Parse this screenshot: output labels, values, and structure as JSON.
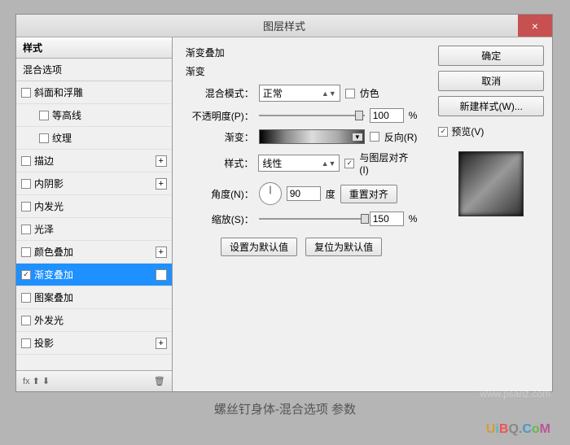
{
  "dialog": {
    "title": "图层样式",
    "close": "×"
  },
  "styles": {
    "header": "样式",
    "blend_options": "混合选项",
    "items": [
      {
        "label": "斜面和浮雕",
        "checked": false,
        "indent": false,
        "has_add": false
      },
      {
        "label": "等高线",
        "checked": false,
        "indent": true,
        "has_add": false
      },
      {
        "label": "纹理",
        "checked": false,
        "indent": true,
        "has_add": false
      },
      {
        "label": "描边",
        "checked": false,
        "indent": false,
        "has_add": true
      },
      {
        "label": "内阴影",
        "checked": false,
        "indent": false,
        "has_add": true
      },
      {
        "label": "内发光",
        "checked": false,
        "indent": false,
        "has_add": false
      },
      {
        "label": "光泽",
        "checked": false,
        "indent": false,
        "has_add": false
      },
      {
        "label": "颜色叠加",
        "checked": false,
        "indent": false,
        "has_add": true
      },
      {
        "label": "渐变叠加",
        "checked": true,
        "indent": false,
        "has_add": true,
        "selected": true
      },
      {
        "label": "图案叠加",
        "checked": false,
        "indent": false,
        "has_add": false
      },
      {
        "label": "外发光",
        "checked": false,
        "indent": false,
        "has_add": false
      },
      {
        "label": "投影",
        "checked": false,
        "indent": false,
        "has_add": true
      }
    ],
    "footer_left": "fx",
    "footer_arrows": "⬆ ⬇",
    "footer_trash": "🗑"
  },
  "panel": {
    "section": "渐变叠加",
    "sub": "渐变",
    "blend_mode_label": "混合模式：",
    "blend_mode_value": "正常",
    "dither_label": "仿色",
    "dither_checked": false,
    "opacity_label": "不透明度(P)：",
    "opacity_value": "100",
    "opacity_unit": "%",
    "gradient_label": "渐变：",
    "reverse_label": "反向(R)",
    "reverse_checked": false,
    "style_label": "样式：",
    "style_value": "线性",
    "align_label": "与图层对齐(I)",
    "align_checked": true,
    "angle_label": "角度(N)：",
    "angle_value": "90",
    "angle_unit": "度",
    "reset_align": "重置对齐",
    "scale_label": "缩放(S)：",
    "scale_value": "150",
    "scale_unit": "%",
    "set_default": "设置为默认值",
    "reset_default": "复位为默认值"
  },
  "buttons": {
    "ok": "确定",
    "cancel": "取消",
    "new_style": "新建样式(W)...",
    "preview_label": "预览(V)",
    "preview_checked": true
  },
  "caption": "螺丝钉身体-混合选项 参数",
  "watermark": "www.psanz.com",
  "logo": {
    "u": "U",
    "i": "i",
    "b": "B",
    "q": "Q.",
    "c": "C",
    "o": "o",
    "m": "M"
  }
}
